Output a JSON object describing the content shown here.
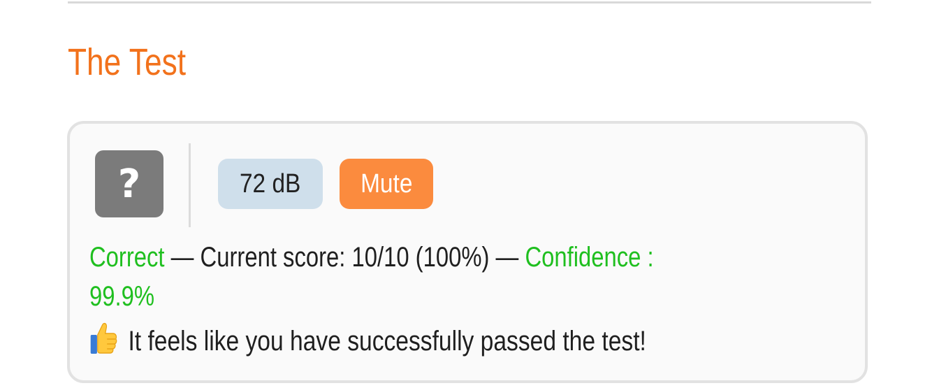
{
  "page": {
    "title": "The Test"
  },
  "test": {
    "question_icon": "question-mark-icon",
    "question_glyph": "?",
    "volume_label": "72 dB",
    "mute_label": "Mute",
    "result": {
      "status": "Correct",
      "separator1": " — Current score: ",
      "score": "10/10 (100%)",
      "separator2": " — ",
      "confidence_label": "Confidence :",
      "confidence_value": "99.9%"
    },
    "pass_icon": "thumbs-up-icon",
    "pass_message": "It feels like you have successfully passed the test!"
  },
  "colors": {
    "title": "#f2721c",
    "correct": "#1fbf1f",
    "mute_button": "#fb8b3e",
    "volume_badge": "#cfdfeb",
    "question_tile": "#7b7b7b"
  }
}
